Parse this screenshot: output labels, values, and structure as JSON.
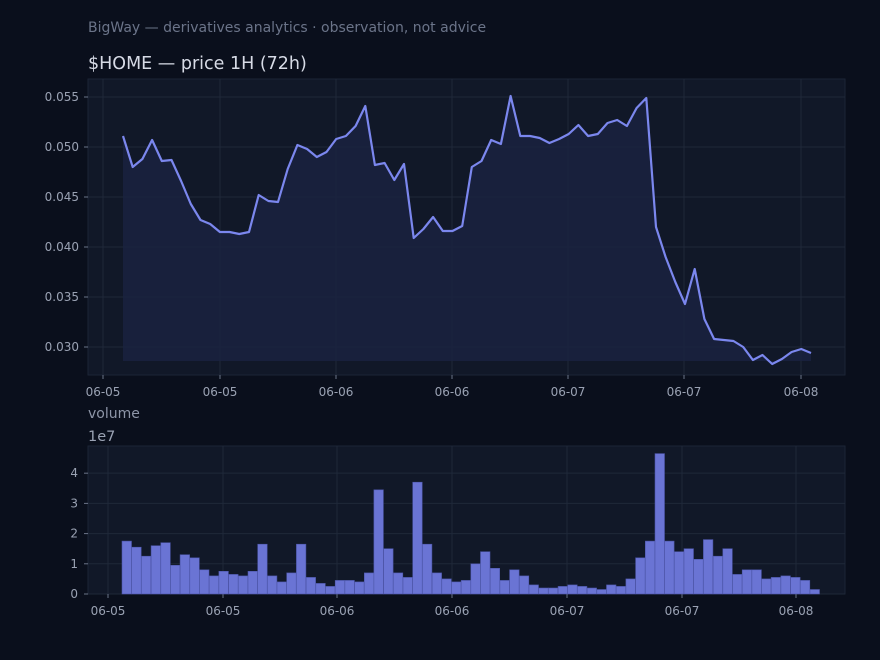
{
  "header": {
    "subtitle": "BigWay — derivatives analytics · observation, not advice"
  },
  "colors": {
    "background": "#0a0f1c",
    "panel": "#111828",
    "line": "#7b87ee",
    "fill": "#1a2240",
    "bar": "#6a74d4"
  },
  "chart_data": [
    {
      "type": "area",
      "title": "$HOME — price 1H (72h)",
      "x_ticks": [
        "06-05",
        "06-05",
        "06-06",
        "06-06",
        "06-07",
        "06-07",
        "06-08"
      ],
      "y_ticks": [
        "0.030",
        "0.035",
        "0.040",
        "0.045",
        "0.050",
        "0.055"
      ],
      "ylim": [
        0.0272,
        0.0568
      ],
      "grid": true,
      "series": [
        {
          "values": [
            0.0511,
            0.048,
            0.0488,
            0.0507,
            0.0486,
            0.0487,
            0.0466,
            0.0443,
            0.0427,
            0.0423,
            0.0415,
            0.0415,
            0.0413,
            0.0415,
            0.0452,
            0.0446,
            0.0445,
            0.0478,
            0.0502,
            0.0498,
            0.049,
            0.0495,
            0.0508,
            0.0511,
            0.0521,
            0.0541,
            0.0482,
            0.0484,
            0.0467,
            0.0483,
            0.0409,
            0.0418,
            0.043,
            0.0416,
            0.0416,
            0.0421,
            0.048,
            0.0486,
            0.0507,
            0.0503,
            0.0551,
            0.0511,
            0.0511,
            0.0509,
            0.0504,
            0.0508,
            0.0513,
            0.0522,
            0.0511,
            0.0513,
            0.0524,
            0.0527,
            0.0521,
            0.0539,
            0.0549,
            0.042,
            0.039,
            0.0365,
            0.0343,
            0.0378,
            0.0328,
            0.0308,
            0.0307,
            0.0306,
            0.03,
            0.0287,
            0.0292,
            0.0283,
            0.0288,
            0.0295,
            0.0298,
            0.0294
          ]
        }
      ]
    },
    {
      "type": "bar",
      "title": "volume",
      "y_offset_label": "1e7",
      "x_ticks": [
        "06-05",
        "06-05",
        "06-06",
        "06-06",
        "06-07",
        "06-07",
        "06-08"
      ],
      "y_ticks": [
        "0",
        "1",
        "2",
        "3",
        "4"
      ],
      "ylim": [
        0,
        4.9
      ],
      "grid": true,
      "series": [
        {
          "values": [
            1.75,
            1.55,
            1.25,
            1.6,
            1.7,
            0.95,
            1.3,
            1.2,
            0.8,
            0.6,
            0.75,
            0.65,
            0.6,
            0.75,
            1.65,
            0.6,
            0.4,
            0.7,
            1.65,
            0.55,
            0.35,
            0.25,
            0.45,
            0.45,
            0.4,
            0.7,
            3.45,
            1.5,
            0.7,
            0.55,
            3.7,
            1.65,
            0.7,
            0.5,
            0.4,
            0.45,
            1.0,
            1.4,
            0.85,
            0.45,
            0.8,
            0.6,
            0.3,
            0.2,
            0.2,
            0.25,
            0.3,
            0.25,
            0.2,
            0.15,
            0.3,
            0.25,
            0.5,
            1.2,
            1.75,
            4.65,
            1.75,
            1.4,
            1.5,
            1.15,
            1.8,
            1.25,
            1.5,
            0.65,
            0.8,
            0.8,
            0.5,
            0.55,
            0.6,
            0.55,
            0.45,
            0.15
          ]
        }
      ]
    }
  ]
}
